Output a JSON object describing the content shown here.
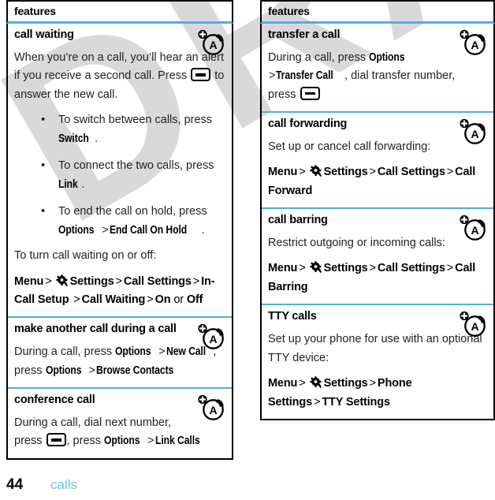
{
  "page": {
    "number": "44",
    "chapter": "calls",
    "watermark": "DRAFT"
  },
  "colors": {
    "separator": "#4db0e0",
    "chapter_text": "#74c3ea",
    "watermark": "#d9d9d9",
    "body_text": "#231f20"
  },
  "columns": [
    {
      "header": "features",
      "sections": [
        {
          "title": "call waiting",
          "icon": "network-service-icon",
          "paragraph_1a": "When you’re on a call, you’ll hear an alert if you receive a second call. Press",
          "paragraph_1b": "to answer the new call.",
          "bullets": [
            {
              "text_a": "To switch between calls, press",
              "ui_1": "Switch",
              "text_b": "."
            },
            {
              "text_a": "To connect the two calls, press",
              "ui_1": "Link",
              "text_b": "."
            },
            {
              "text_a": "To end the call on hold, press",
              "ui_1": "Options",
              "sep": ">",
              "ui_2": "End Call On Hold",
              "text_b": "."
            }
          ],
          "paragraph_2": "To turn call waiting on or off:",
          "navpath": {
            "root": "Menu",
            "icon": "gear-icon",
            "items": [
              "Settings",
              "Call Settings",
              "In-Call Setup",
              "Call Waiting",
              "On"
            ],
            "or_label": "or",
            "last_item": "Off"
          }
        },
        {
          "title": "make another call during a call",
          "icon": "network-service-icon",
          "paragraph_1a": "During a call, press",
          "ui_1": "Options",
          "sep_1": ">",
          "ui_2": "New Call",
          "comma": ",",
          "paragraph_1b": "press",
          "ui_3": "Options",
          "sep_2": ">",
          "ui_4": "Browse Contacts"
        },
        {
          "title": "conference call",
          "icon": "network-service-icon",
          "paragraph_1a": "During a call, dial next number,",
          "paragraph_1b": "press",
          "key_icon": "send-key-icon",
          "comma": ", press",
          "ui_1": "Options",
          "sep_1": ">",
          "ui_2": "Link Calls"
        }
      ]
    },
    {
      "header": "features",
      "sections": [
        {
          "title": "transfer a call",
          "icon": "network-service-icon",
          "paragraph_1a": "During a call, press",
          "ui_1": "Options",
          "sep_1": ">",
          "ui_2": "Transfer Call",
          "paragraph_1b": ", dial transfer number,",
          "paragraph_1c": "press",
          "key_icon": "send-key-icon"
        },
        {
          "title": "call forwarding",
          "icon": "network-service-icon",
          "paragraph_1": "Set up or cancel call forwarding:",
          "navpath": {
            "root": "Menu",
            "icon": "gear-icon",
            "items": [
              "Settings",
              "Call Settings",
              "Call Forward"
            ]
          }
        },
        {
          "title": "call barring",
          "icon": "network-service-icon",
          "paragraph_1": "Restrict outgoing or incoming calls:",
          "navpath": {
            "root": "Menu",
            "icon": "gear-icon",
            "items": [
              "Settings",
              "Call Settings",
              "Call Barring"
            ]
          }
        },
        {
          "title": "TTY calls",
          "icon": "network-service-icon",
          "paragraph_1": "Set up your phone for use with an optional TTY device:",
          "navpath": {
            "root": "Menu",
            "icon": "gear-icon",
            "items": [
              "Settings",
              "Phone Settings",
              "TTY Settings"
            ]
          }
        }
      ]
    }
  ]
}
